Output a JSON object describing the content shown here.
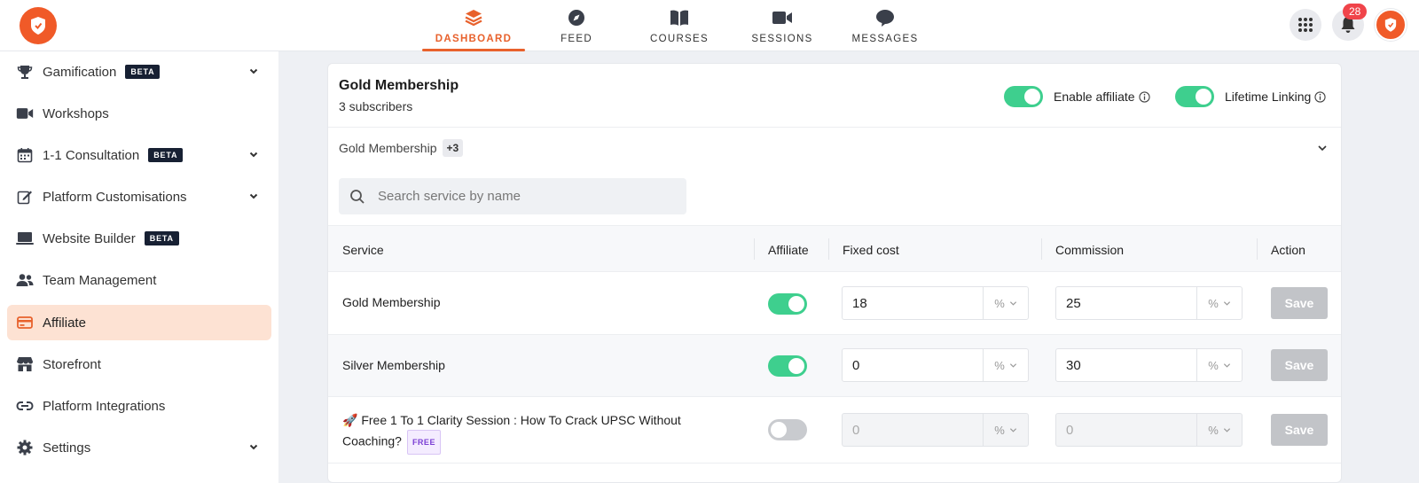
{
  "colors": {
    "brand": "#e8612c",
    "toggle_on": "#3ecf8e",
    "active_bg": "#fde2d3",
    "notif": "#f0444a"
  },
  "topnav": {
    "items": [
      {
        "label": "DASHBOARD",
        "icon": "layers-icon"
      },
      {
        "label": "FEED",
        "icon": "compass-icon"
      },
      {
        "label": "COURSES",
        "icon": "book-icon"
      },
      {
        "label": "SESSIONS",
        "icon": "video-icon"
      },
      {
        "label": "MESSAGES",
        "icon": "chat-icon"
      }
    ],
    "active": "DASHBOARD",
    "notification_count": "28"
  },
  "sidebar": {
    "items": [
      {
        "label": "Gamification",
        "icon": "trophy-icon",
        "badge": "BETA",
        "has_chevron": true
      },
      {
        "label": "Workshops",
        "icon": "video-icon"
      },
      {
        "label": "1-1 Consultation",
        "icon": "calendar-icon",
        "badge": "BETA",
        "has_chevron": true
      },
      {
        "label": "Platform Customisations",
        "icon": "edit-icon",
        "has_chevron": true
      },
      {
        "label": "Website Builder",
        "icon": "laptop-icon",
        "badge": "BETA"
      },
      {
        "label": "Team Management",
        "icon": "people-icon"
      },
      {
        "label": "Affiliate",
        "icon": "card-icon",
        "active": true
      },
      {
        "label": "Storefront",
        "icon": "store-icon"
      },
      {
        "label": "Platform Integrations",
        "icon": "link-icon"
      },
      {
        "label": "Settings",
        "icon": "gear-icon",
        "has_chevron": true
      }
    ]
  },
  "card": {
    "title": "Gold Membership",
    "subtitle": "3 subscribers",
    "enable_affiliate_label": "Enable affiliate",
    "lifetime_linking_label": "Lifetime Linking",
    "enable_affiliate_on": true,
    "lifetime_linking_on": true,
    "dropdown": {
      "label": "Gold Membership",
      "extra": "+3"
    },
    "search": {
      "placeholder": "Search service by name",
      "value": ""
    }
  },
  "table": {
    "headers": {
      "service": "Service",
      "affiliate": "Affiliate",
      "fixed_cost": "Fixed cost",
      "commission": "Commission",
      "action": "Action"
    },
    "unit_label": "%",
    "save_label": "Save",
    "rows": [
      {
        "service": "Gold Membership",
        "affiliate": true,
        "fixed_cost": "18",
        "commission": "25"
      },
      {
        "service": "Silver Membership",
        "affiliate": true,
        "fixed_cost": "0",
        "commission": "30"
      },
      {
        "service": "🚀 Free 1 To 1 Clarity Session : How To Crack UPSC Without Coaching?",
        "affiliate": false,
        "fixed_cost": "0",
        "commission": "0",
        "badge": "FREE"
      }
    ]
  }
}
